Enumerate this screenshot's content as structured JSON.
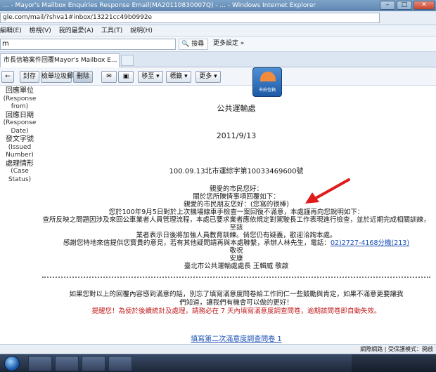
{
  "window": {
    "title": "... - Mayor's Mailbox Enquiries Response Email(MA20110830007Q) - ... - Windows Internet Explorer",
    "controls": [
      "minimize",
      "maximize",
      "close"
    ]
  },
  "address_bar": {
    "url": "gle.com/mail/?shva1#inbox/13221cc49b0992e"
  },
  "menu": [
    "編輯(E)",
    "檢視(V)",
    "我的最愛(A)",
    "工具(T)",
    "說明(H)"
  ],
  "search": {
    "value": "m",
    "search_button": "搜尋",
    "more_button": "更多設定 »"
  },
  "tab": {
    "label": "市長信箱案件回覆Mayor's Mailbox E..."
  },
  "toolbar": {
    "archive": "封存",
    "report_spam": "檢舉垃圾郵件",
    "delete": "刪除",
    "move": "移至",
    "labels": "標籤",
    "more": "更多"
  },
  "logo": {
    "text": "市府信箱"
  },
  "fields": [
    {
      "zh": "回應單位",
      "en": "(Response from)"
    },
    {
      "zh": "回應日期",
      "en": "(Response Date)"
    },
    {
      "zh": "發文字號",
      "en": "(Issued Number)"
    },
    {
      "zh": "處理情形",
      "en": "(Case Status)"
    }
  ],
  "letter": {
    "org": "公共運輸處",
    "date": "2011/9/13",
    "doc_no": "100.09.13北市運綜字第10033469600號",
    "lines": [
      "親愛的市民您好：",
      "關於您所陳情事項回覆如下：",
      "親愛的市民朋友您好：(您寫的很棒)",
      "您於100年9月5日對於上次機場線車手檢查一案回復不滿意，本處謹再向您說明如下：",
      "查所反映之問題因涉及來回公車業者人員管理流程，本處已要求業者應依規定對駕駛長工作表現進行檢查，並於近期完成相關訓練，至該",
      "業者表示日後將加強人員教育訓練。倘您仍有疑義，歡迎洽詢本處。",
      "感謝您特地來信提供您寶貴的意見，若有其他疑問請再與本處聯繫，承辦人林先生，電話：",
      "敬祝",
      "安康",
      "臺北市公共運輸處處長 王輯威 敬啟"
    ],
    "phone": "02)2727-4168分機(213)",
    "satisfaction_line1": "如果您對以上的回覆內容感到滿意的話，別忘了填寫滿意度問卷給工作同仁一些鼓勵與肯定，如果不滿意更要讓我",
    "satisfaction_line2": "們知道，讓我們有機會可以做的更好！",
    "reminder": "提醒您！為便於後續統計及處理，請務必在 7 天內填寫滿意度調查問卷，逾期該問卷即自動失效。",
    "survey_link": "填寫第二次滿意度調查問卷 1"
  },
  "status_bar": {
    "zone": "網際網路 | 受保護模式：開啟"
  }
}
